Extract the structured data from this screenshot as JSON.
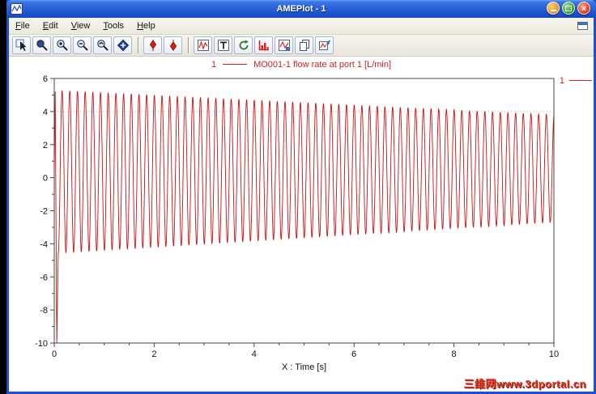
{
  "window": {
    "title": "AMEPlot - 1"
  },
  "menu": {
    "items": [
      "File",
      "Edit",
      "View",
      "Tools",
      "Help"
    ]
  },
  "toolbar": {
    "icons": [
      "select-pointer",
      "zoom-window",
      "zoom-in",
      "zoom-out",
      "zoom-reset",
      "fit-view",
      "cursor-marker-a",
      "cursor-marker-b",
      "new-plot",
      "add-text",
      "replot",
      "bar-chart",
      "curve-style",
      "copy",
      "export-plot"
    ]
  },
  "legend": {
    "series_no": "1",
    "label": "MO001-1 flow rate at port 1 [L/min]"
  },
  "right_marker": {
    "series_no": "1"
  },
  "watermark": {
    "text": "三维网www.3dportal.cn"
  },
  "chart_data": {
    "type": "line",
    "title": "",
    "xlabel": "X : Time [s]",
    "ylabel": "",
    "xlim": [
      0,
      10
    ],
    "ylim": [
      -10,
      6
    ],
    "x_ticks": [
      0,
      2,
      4,
      6,
      8,
      10
    ],
    "y_ticks": [
      6,
      4,
      2,
      0,
      -2,
      -4,
      -6,
      -8,
      -10
    ],
    "x_minor_step": 0.5,
    "y_minor_step": 1,
    "grid_y": [
      4
    ],
    "grid_style": "dotted",
    "legend_position": "top-center",
    "series": [
      {
        "name": "MO001-1 flow rate at port 1 [L/min]",
        "color": "#cc1111",
        "signal": {
          "kind": "decaying_sine",
          "frequency_hz": 6.5,
          "amp_start": 4.95,
          "amp_end": 3.25,
          "offset_start": 0.35,
          "offset_end": 0.55,
          "transient": [
            [
              0,
              0.3
            ],
            [
              0.02,
              5.2
            ],
            [
              0.05,
              -10
            ],
            [
              0.08,
              -4.6
            ]
          ]
        }
      }
    ]
  }
}
